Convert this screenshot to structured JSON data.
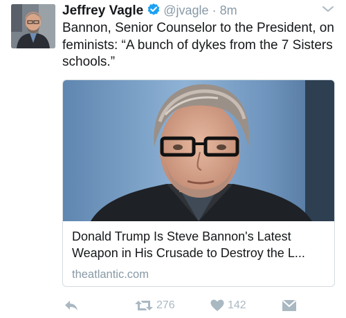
{
  "tweet": {
    "author_name": "Jeffrey Vagle",
    "handle": "@jvagle",
    "separator": "·",
    "time": "8m",
    "text": "Bannon, Senior Counselor to the President, on feminists: “A bunch of dykes from the 7 Sisters schools.”"
  },
  "card": {
    "title_line1": "Donald Trump Is Steve Bannon's Latest",
    "title_line2": "Weapon in His Crusade to Destroy the L...",
    "domain": "theatlantic.com"
  },
  "actions": {
    "retweet_count": "276",
    "like_count": "142"
  },
  "colors": {
    "verified_blue": "#1da1f2",
    "muted_gray": "#8899a6",
    "icon_gray": "#aab8c2"
  },
  "icons": [
    "verified-badge-icon",
    "chevron-down-icon",
    "reply-icon",
    "retweet-icon",
    "heart-icon",
    "direct-message-icon"
  ]
}
